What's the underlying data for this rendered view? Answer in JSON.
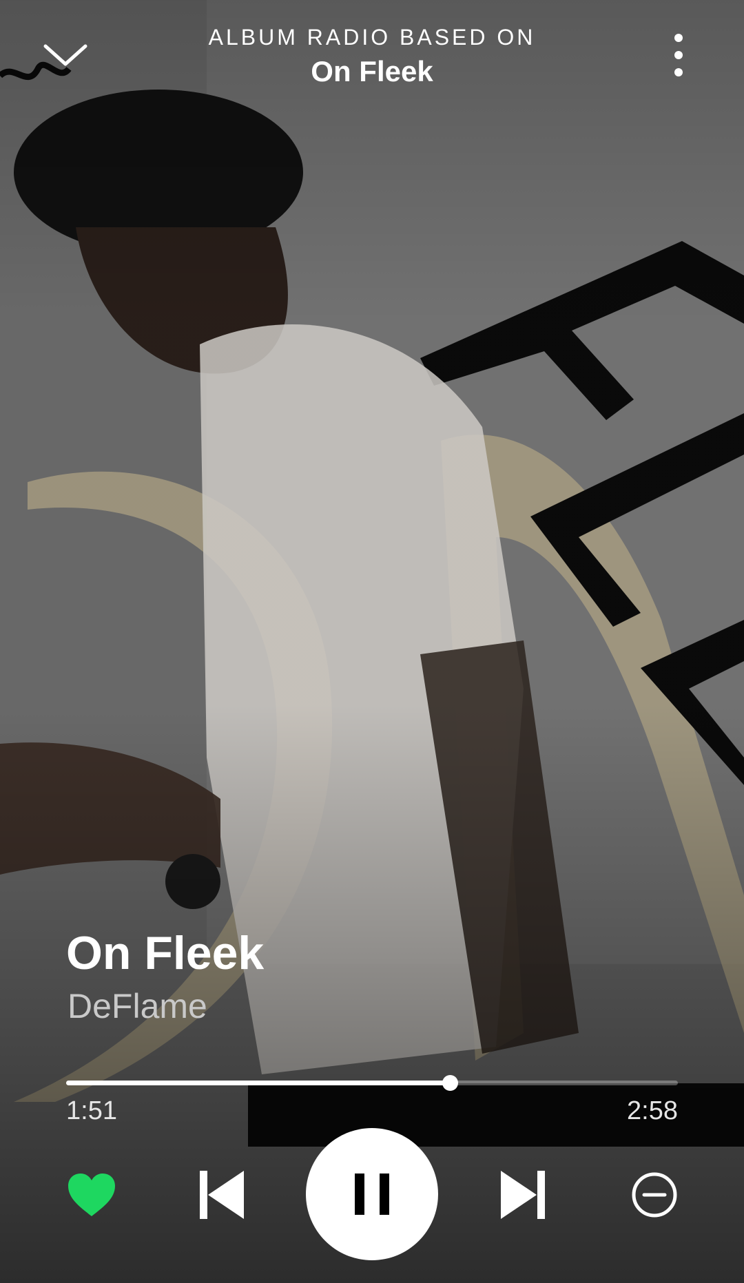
{
  "header": {
    "context_label": "ALBUM RADIO BASED ON",
    "context_title": "On Fleek"
  },
  "track": {
    "title": "On Fleek",
    "artist": "DeFlame"
  },
  "playback": {
    "elapsed": "1:51",
    "duration": "2:58",
    "progress_fraction": 0.627,
    "state": "playing"
  },
  "controls": {
    "liked": true
  },
  "icons": {
    "collapse": "chevron-down-icon",
    "more": "more-vertical-icon",
    "like": "heart-icon",
    "previous": "skip-previous-icon",
    "pause": "pause-icon",
    "next": "skip-next-icon",
    "ban": "minus-circle-icon"
  },
  "colors": {
    "accent_green": "#1ed760",
    "text_primary": "#ffffff",
    "text_secondary": "#c9c9c9"
  }
}
